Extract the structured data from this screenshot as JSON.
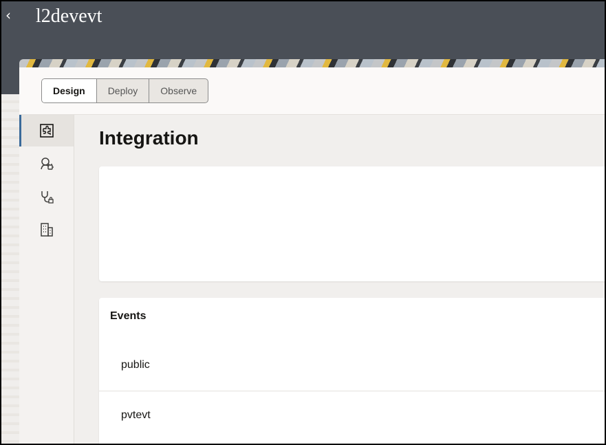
{
  "header": {
    "title": "l2devevt",
    "back_icon": "chevron-left-icon"
  },
  "tabs": [
    {
      "label": "Design",
      "active": true
    },
    {
      "label": "Deploy",
      "active": false
    },
    {
      "label": "Observe",
      "active": false
    }
  ],
  "rail": [
    {
      "icon": "integration-puzzle-icon",
      "active": true
    },
    {
      "icon": "connection-plug-icon",
      "active": false
    },
    {
      "icon": "health-check-icon",
      "active": false
    },
    {
      "icon": "building-icon",
      "active": false
    }
  ],
  "main": {
    "page_title": "Integration",
    "events": {
      "title": "Events",
      "items": [
        "public",
        "pvtevt"
      ]
    }
  },
  "colors": {
    "header_bg": "#4a4f57",
    "active_rail_indicator": "#3a6a9a"
  }
}
